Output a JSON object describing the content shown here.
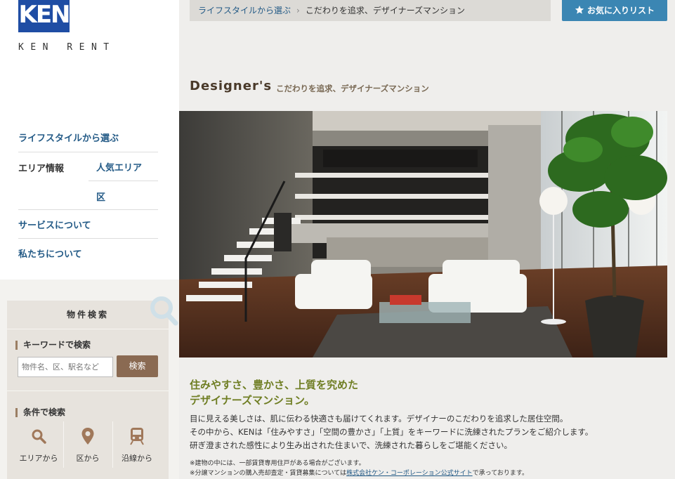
{
  "logo": {
    "mark": "KEN",
    "text": "KEN RENT"
  },
  "nav": {
    "lifestyle": "ライフスタイルから選ぶ",
    "area_info": "エリア情報",
    "popular_area": "人気エリア",
    "ward": "区",
    "services": "サービスについて",
    "about": "私たちについて"
  },
  "search": {
    "title": "物件検索",
    "keyword_heading": "キーワードで検索",
    "keyword_placeholder": "物件名、区、駅名など",
    "search_button": "検索",
    "condition_heading": "条件で検索",
    "by_area": "エリアから",
    "by_ward": "区から",
    "by_line": "沿線から"
  },
  "breadcrumb": {
    "parent": "ライフスタイルから選ぶ",
    "separator": "›",
    "current": "こだわりを追求、デザイナーズマンション"
  },
  "favorites_button": "お気に入りリスト",
  "page": {
    "title": "Designer's",
    "subtitle": "こだわりを追求、デザイナーズマンション"
  },
  "content": {
    "headline_1": "住みやすさ、豊かさ、上質を究めた",
    "headline_2": "デザイナーズマンション。",
    "body_1": "目に見える美しさは、肌に伝わる快適さも届けてくれます。デザイナーのこだわりを追求した居住空間。",
    "body_2": "その中から、KENは「住みやすさ」「空間の豊かさ」「上質」をキーワードに洗練されたプランをご紹介します。",
    "body_3": "研ぎ澄まされた感性により生み出された住まいで、洗練された暮らしをご堪能ください。",
    "note_1": "※建物の中には、一部賃貸専用住戸がある場合がございます。",
    "note_2_pre": "※分譲マンションの購入売却査定・賃貸募集については",
    "note_2_link": "株式会社ケン・コーポレーション公式サイト",
    "note_2_post": "で承っております。"
  },
  "colors": {
    "brand_blue": "#1f4da4",
    "link_blue": "#235a86",
    "fav_button": "#3b86b3",
    "search_button": "#8a6a52",
    "headline_green": "#6f7e23"
  }
}
